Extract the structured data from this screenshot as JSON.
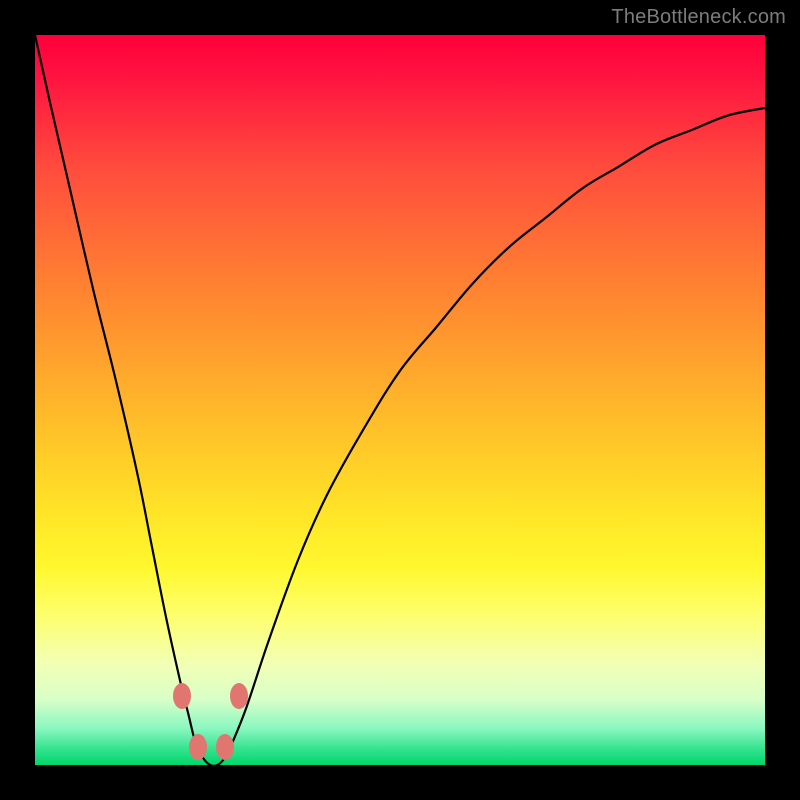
{
  "watermark": "TheBottleneck.com",
  "colors": {
    "page_bg": "#000000",
    "curve": "#000000",
    "knob": "#e0766f",
    "watermark": "#7c7c7c",
    "gradient_top": "#ff003a",
    "gradient_bottom": "#00d76a"
  },
  "chart_data": {
    "type": "line",
    "title": "",
    "xlabel": "",
    "ylabel": "",
    "xlim": [
      0,
      100
    ],
    "ylim": [
      0,
      100
    ],
    "grid": false,
    "series": [
      {
        "name": "bottleneck-curve",
        "x": [
          0,
          2,
          5,
          8,
          11,
          14,
          16,
          18,
          20,
          21,
          22,
          23,
          24,
          25,
          26,
          27,
          29,
          32,
          36,
          40,
          45,
          50,
          55,
          60,
          65,
          70,
          75,
          80,
          85,
          90,
          95,
          100
        ],
        "y": [
          100,
          91,
          78,
          65,
          53,
          40,
          30,
          20,
          11,
          7,
          3,
          1,
          0,
          0,
          1,
          3,
          8,
          17,
          28,
          37,
          46,
          54,
          60,
          66,
          71,
          75,
          79,
          82,
          85,
          87,
          89,
          90
        ]
      }
    ],
    "knobs": [
      {
        "x": 20.2,
        "y": 9.5
      },
      {
        "x": 22.3,
        "y": 2.5
      },
      {
        "x": 26.0,
        "y": 2.5
      },
      {
        "x": 28.0,
        "y": 9.5
      }
    ]
  }
}
